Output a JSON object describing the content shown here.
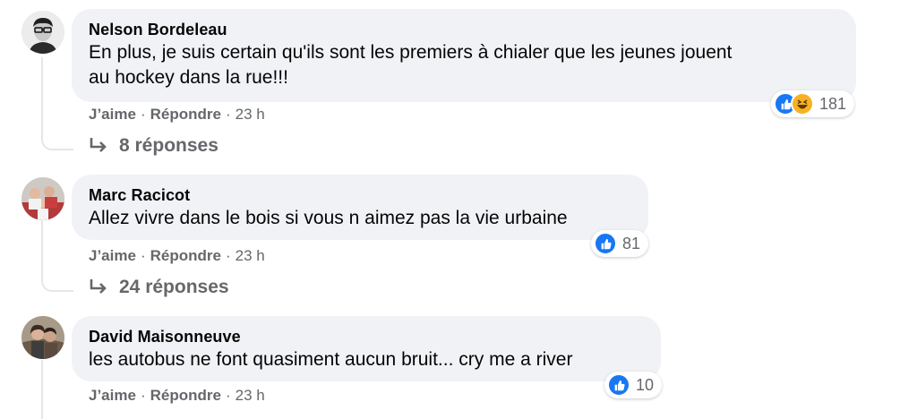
{
  "comments": [
    {
      "author": "Nelson Bordeleau",
      "text_line1": "En plus, je suis certain qu'ils sont les premiers à chialer que les jeunes jouent",
      "text_line2": "au hockey dans la rue!!!",
      "like_label": "J’aime",
      "reply_label": "Répondre",
      "separator": "·",
      "time": "23 h",
      "reactions": [
        "like-icon",
        "haha-icon"
      ],
      "reaction_count": "181",
      "replies_label": "8 réponses"
    },
    {
      "author": "Marc Racicot",
      "text_line1": "Allez vivre dans le bois si vous n aimez pas la vie urbaine",
      "like_label": "J’aime",
      "reply_label": "Répondre",
      "separator": "·",
      "time": "23 h",
      "reactions": [
        "like-icon"
      ],
      "reaction_count": "81",
      "replies_label": "24 réponses"
    },
    {
      "author": "David Maisonneuve",
      "text_line1": "les autobus ne font quasiment aucun bruit... cry me a river",
      "like_label": "J’aime",
      "reply_label": "Répondre",
      "separator": "·",
      "time": "23 h",
      "reactions": [
        "like-icon"
      ],
      "reaction_count": "10"
    }
  ],
  "colors": {
    "bubble": "#f0f2f5",
    "secondary_text": "#65676b",
    "like_blue": "#1877f2",
    "haha_yellow": "#f7b125",
    "thread_line": "#e4e6eb"
  }
}
